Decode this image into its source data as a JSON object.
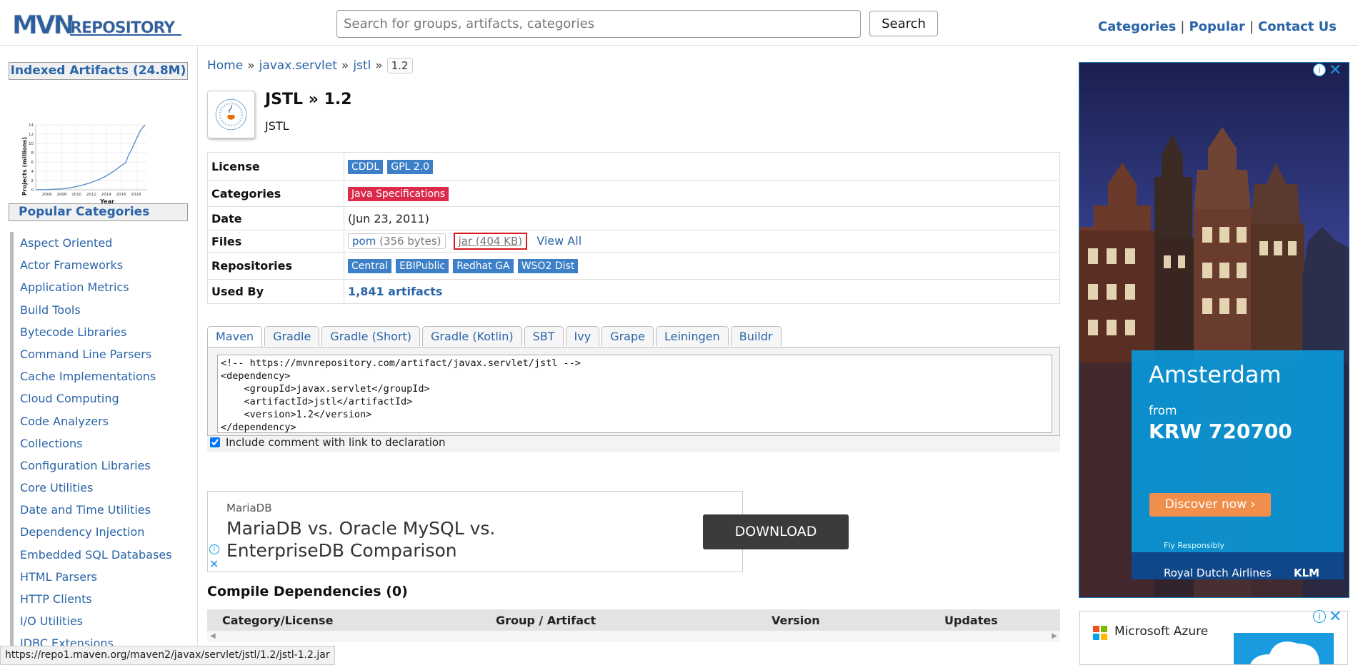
{
  "header": {
    "logo_text": "MVNREPOSITORY",
    "search_placeholder": "Search for groups, artifacts, categories",
    "search_button": "Search",
    "nav": [
      "Categories",
      "Popular",
      "Contact Us"
    ]
  },
  "sidebar": {
    "indexed_title": "Indexed Artifacts (24.8M)",
    "popular_title": "Popular Categories",
    "categories": [
      "Aspect Oriented",
      "Actor Frameworks",
      "Application Metrics",
      "Build Tools",
      "Bytecode Libraries",
      "Command Line Parsers",
      "Cache Implementations",
      "Cloud Computing",
      "Code Analyzers",
      "Collections",
      "Configuration Libraries",
      "Core Utilities",
      "Date and Time Utilities",
      "Dependency Injection",
      "Embedded SQL Databases",
      "HTML Parsers",
      "HTTP Clients",
      "I/O Utilities",
      "JDBC Extensions"
    ]
  },
  "chart_data": {
    "type": "line",
    "title": "",
    "xlabel": "Year",
    "ylabel": "Projects (millions)",
    "x_ticks": [
      "2006",
      "2008",
      "2010",
      "2012",
      "2014",
      "2016",
      "2018"
    ],
    "y_ticks": [
      "0",
      "2",
      "4",
      "6",
      "8",
      "10",
      "12",
      "14"
    ],
    "xlim": [
      2004.5,
      2019.5
    ],
    "ylim": [
      0,
      14
    ],
    "x": [
      2004.5,
      2006,
      2008,
      2009,
      2010,
      2011,
      2012,
      2013,
      2014,
      2015,
      2016,
      2016.6,
      2017,
      2017.5,
      2018,
      2018.6,
      2019.2
    ],
    "y": [
      0,
      0.05,
      0.2,
      0.4,
      0.7,
      1.1,
      1.6,
      2.2,
      3.0,
      4.0,
      5.2,
      5.8,
      7.5,
      9.0,
      10.8,
      12.8,
      14.0
    ],
    "grid": true
  },
  "breadcrumb": {
    "home": "Home",
    "group": "javax.servlet",
    "artifact": "jstl",
    "version": "1.2"
  },
  "artifact": {
    "title": "JSTL » 1.2",
    "subtitle": "JSTL"
  },
  "info": {
    "license_label": "License",
    "licenses": [
      "CDDL",
      "GPL 2.0"
    ],
    "categories_label": "Categories",
    "category": "Java Specifications",
    "date_label": "Date",
    "date": "(Jun 23, 2011)",
    "files_label": "Files",
    "pom_name": "pom",
    "pom_size": "(356 bytes)",
    "jar_label": "jar (404 KB)",
    "view_all": "View All",
    "repositories_label": "Repositories",
    "repositories": [
      "Central",
      "EBIPublic",
      "Redhat GA",
      "WSO2 Dist"
    ],
    "used_by_label": "Used By",
    "used_by": "1,841 artifacts"
  },
  "tabs": [
    "Maven",
    "Gradle",
    "Gradle (Short)",
    "Gradle (Kotlin)",
    "SBT",
    "Ivy",
    "Grape",
    "Leiningen",
    "Buildr"
  ],
  "snippet": "<!-- https://mvnrepository.com/artifact/javax.servlet/jstl -->\n<dependency>\n    <groupId>javax.servlet</groupId>\n    <artifactId>jstl</artifactId>\n    <version>1.2</version>\n</dependency>",
  "include_comment": "Include comment with link to declaration",
  "ad_banner": {
    "brand": "MariaDB",
    "headline": "MariaDB vs. Oracle MySQL vs. EnterpriseDB Comparison",
    "button": "DOWNLOAD"
  },
  "dependencies": {
    "title": "Compile Dependencies (0)",
    "columns": [
      "Category/License",
      "Group / Artifact",
      "Version",
      "Updates"
    ]
  },
  "ad_side": {
    "city": "Amsterdam",
    "from": "from",
    "price": "KRW 720700",
    "button": "Discover now ›",
    "fly": "Fly Responsibly",
    "airline": "Royal Dutch Airlines",
    "brand": "KLM"
  },
  "ad_azure": {
    "name": "Microsoft Azure"
  },
  "status_bar": "https://repo1.maven.org/maven2/javax/servlet/jstl/1.2/jstl-1.2.jar",
  "colors": {
    "link": "#2a64a8",
    "badge": "#3d80c7",
    "category_badge": "#dc2a4a",
    "highlight": "#d9191c",
    "ad_blue": "#1a9be0"
  }
}
